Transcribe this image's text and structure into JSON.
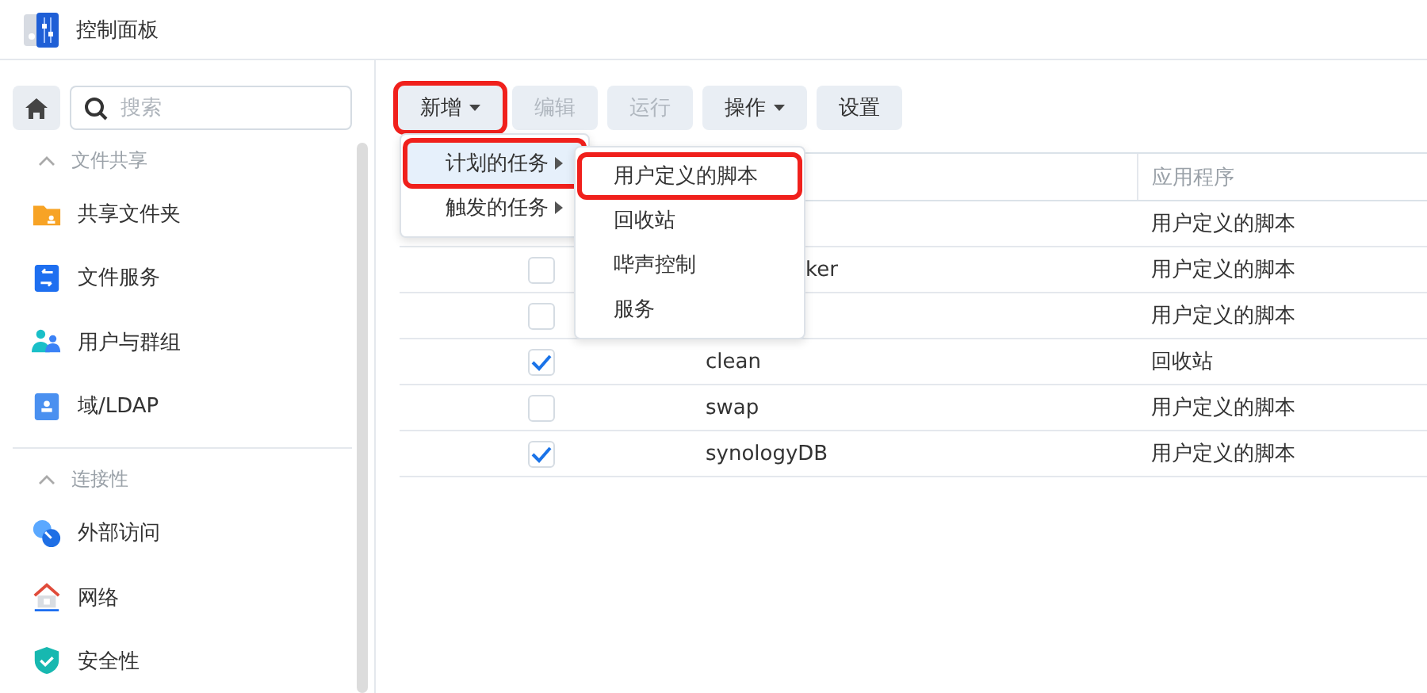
{
  "window": {
    "title": "控制面板"
  },
  "sidebar": {
    "search": {
      "placeholder": "搜索"
    },
    "sections": [
      {
        "title": "文件共享",
        "expanded": true,
        "items": [
          {
            "label": "共享文件夹",
            "kind": "folder"
          },
          {
            "label": "文件服务",
            "kind": "fileservice"
          },
          {
            "label": "用户与群组",
            "kind": "users"
          },
          {
            "label": "域/LDAP",
            "kind": "ldap"
          }
        ]
      },
      {
        "title": "连接性",
        "expanded": true,
        "items": [
          {
            "label": "外部访问",
            "kind": "external"
          },
          {
            "label": "网络",
            "kind": "network"
          },
          {
            "label": "安全性",
            "kind": "security"
          }
        ]
      }
    ]
  },
  "toolbar": [
    {
      "label": "新增",
      "dropdown": true,
      "disabled": false,
      "highlighted": true
    },
    {
      "label": "编辑",
      "dropdown": false,
      "disabled": true,
      "highlighted": false
    },
    {
      "label": "运行",
      "dropdown": false,
      "disabled": true,
      "highlighted": false
    },
    {
      "label": "操作",
      "dropdown": true,
      "disabled": false,
      "highlighted": false
    },
    {
      "label": "设置",
      "dropdown": false,
      "disabled": false,
      "highlighted": false
    }
  ],
  "table": {
    "columns": [
      {
        "label": "应用程序"
      }
    ],
    "rows": [
      {
        "application": "用户定义的脚本"
      },
      {
        "checked": false,
        "name": "ker",
        "name_covered": true,
        "application": "用户定义的脚本"
      },
      {
        "checked": false,
        "application": "用户定义的脚本"
      },
      {
        "checked": true,
        "name": "clean",
        "application": "回收站"
      },
      {
        "checked": false,
        "name": "swap",
        "application": "用户定义的脚本"
      },
      {
        "checked": true,
        "name": "synologyDB",
        "application": "用户定义的脚本"
      }
    ]
  },
  "menu": {
    "items": [
      {
        "label": "计划的任务",
        "selected": true,
        "highlighted": true
      },
      {
        "label": "触发的任务",
        "selected": false,
        "highlighted": false
      }
    ]
  },
  "submenu": {
    "items": [
      {
        "label": "用户定义的脚本",
        "highlighted": true
      },
      {
        "label": "回收站",
        "highlighted": false
      },
      {
        "label": "哔声控制",
        "highlighted": false
      },
      {
        "label": "服务",
        "highlighted": false
      }
    ]
  }
}
